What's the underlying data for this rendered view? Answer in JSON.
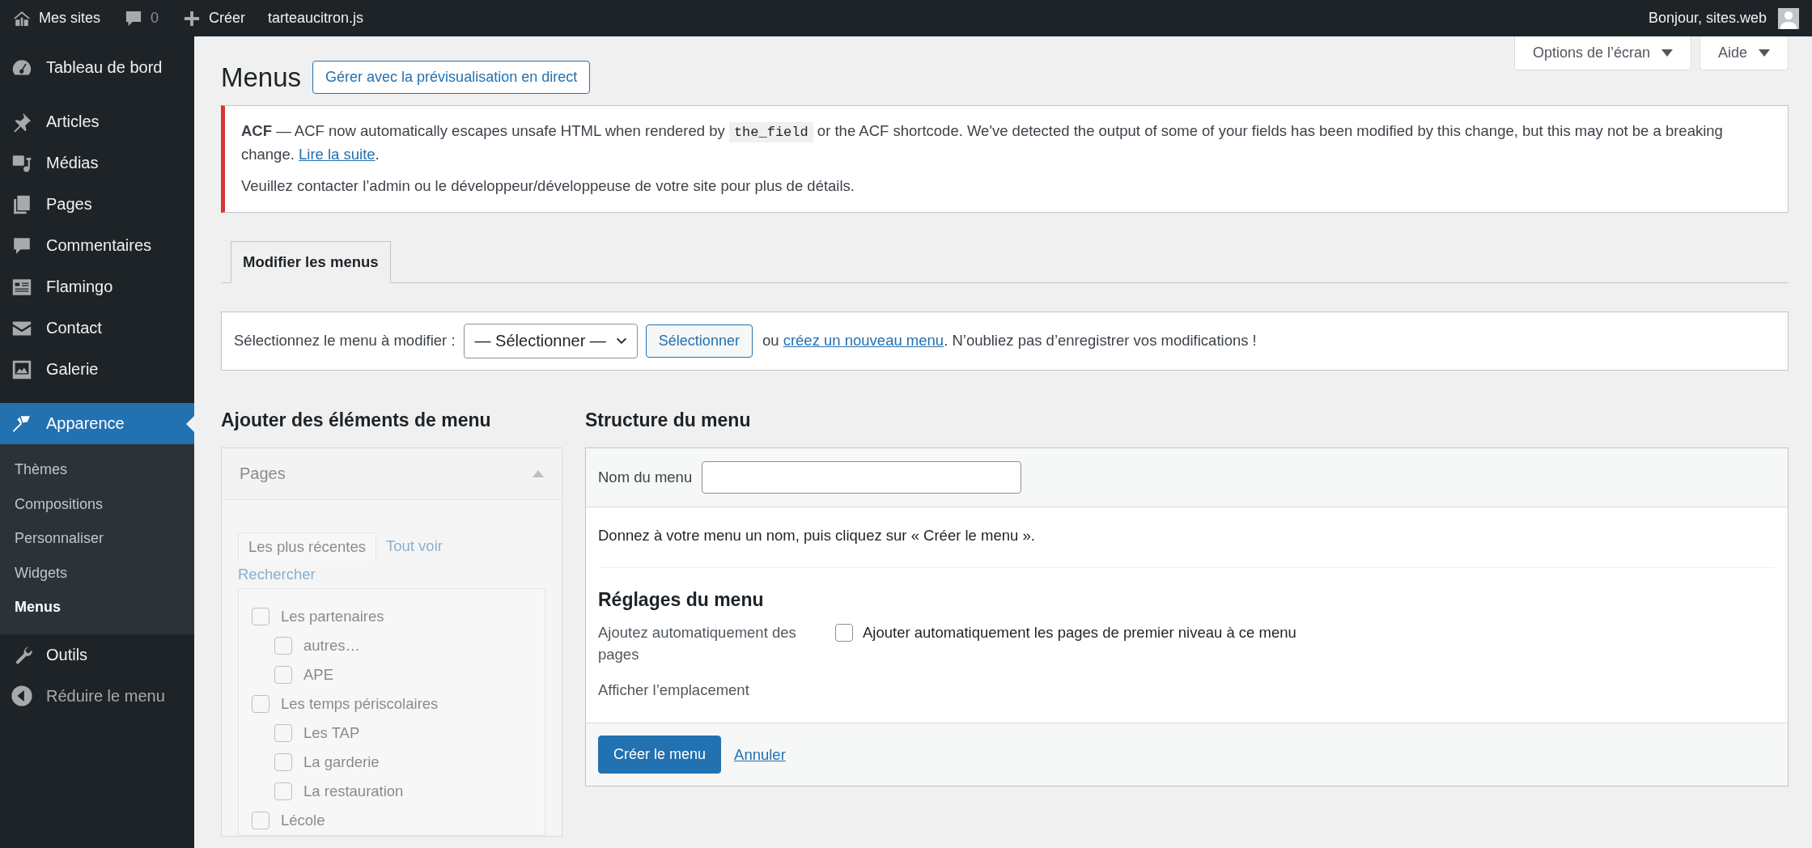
{
  "admin_bar": {
    "items": [
      {
        "kind": "sites",
        "label": "Mes sites"
      },
      {
        "kind": "comments",
        "label": "0"
      },
      {
        "kind": "new",
        "label": "Créer"
      },
      {
        "kind": "plain",
        "label": "tarteaucitron.js"
      }
    ],
    "greeting": "Bonjour, sites.web"
  },
  "sidebar": {
    "items": [
      {
        "label": "Tableau de bord",
        "selected": false
      },
      {
        "label": "Articles",
        "selected": false
      },
      {
        "label": "Médias",
        "selected": false
      },
      {
        "label": "Pages",
        "selected": false
      },
      {
        "label": "Commentaires",
        "selected": false
      },
      {
        "label": "Flamingo",
        "selected": false
      },
      {
        "label": "Contact",
        "selected": false
      },
      {
        "label": "Galerie",
        "selected": false
      },
      {
        "label": "Apparence",
        "selected": true,
        "children": [
          {
            "label": "Thèmes",
            "selected": false
          },
          {
            "label": "Compositions",
            "selected": false
          },
          {
            "label": "Personnaliser",
            "selected": false
          },
          {
            "label": "Widgets",
            "selected": false
          },
          {
            "label": "Menus",
            "selected": true
          }
        ]
      },
      {
        "label": "Outils",
        "selected": false
      },
      {
        "label": "Réduire le menu",
        "selected": false
      }
    ]
  },
  "screen_meta": [
    "Options de l’écran",
    "Aide"
  ],
  "page_title": "Menus",
  "title_action": "Gérer avec la prévisualisation en direct",
  "notice": {
    "before": "**ACF** — ACF now automatically escapes unsafe HTML when rendered by",
    "code": "the_field",
    "after": "or the ACF shortcode. We've detected the output of some of your fields has been modified by this change, but this may not be a breaking change.",
    "link": "Lire la suite",
    "end": ".",
    "second": "Veuillez contacter l’admin ou le développeur/développeuse de votre site pour plus de détails."
  },
  "tabs": [
    {
      "label": "Modifier les menus",
      "selected": true
    }
  ],
  "select_bar": {
    "label": "Sélectionnez le menu à modifier :",
    "dropdown": "— Sélectionner —",
    "button": "Sélectionner",
    "before": "ou",
    "link": "créez un nouveau menu",
    "after": ". N’oubliez pas d’enregistrer vos modifications !"
  },
  "add_items": {
    "heading": "Ajouter des éléments de menu",
    "panel": {
      "title": "Pages",
      "expanded": true,
      "disabled": true,
      "tabs": [
        {
          "label": "Les plus récentes",
          "selected": true
        },
        {
          "label": "Tout voir",
          "selected": false
        },
        {
          "label": "Rechercher",
          "selected": false
        }
      ],
      "pages": [
        {
          "label": "Les partenaires",
          "checked": false,
          "children": [
            {
              "label": "autres…",
              "checked": false
            },
            {
              "label": "APE",
              "checked": false
            }
          ]
        },
        {
          "label": "Les temps périscolaires",
          "checked": false,
          "children": [
            {
              "label": "Les TAP",
              "checked": false
            },
            {
              "label": "La garderie",
              "checked": false
            },
            {
              "label": "La restauration",
              "checked": false
            }
          ]
        },
        {
          "label": "Lécole",
          "checked": false
        }
      ]
    }
  },
  "structure": {
    "heading": "Structure du menu",
    "name_label": "Nom du menu",
    "instructions": "Donnez à votre menu un nom, puis cliquez sur « Créer le menu ».",
    "settings_heading": "Réglages du menu",
    "settings": [
      {
        "kind": "checkbox",
        "label": "Ajoutez automatiquement des pages",
        "option": "Ajouter automatiquement les pages de premier niveau à ce menu",
        "checked": false
      },
      {
        "kind": "label",
        "label": "Afficher l’emplacement"
      }
    ],
    "create_button": "Créer le menu",
    "cancel_link": "Annuler"
  }
}
